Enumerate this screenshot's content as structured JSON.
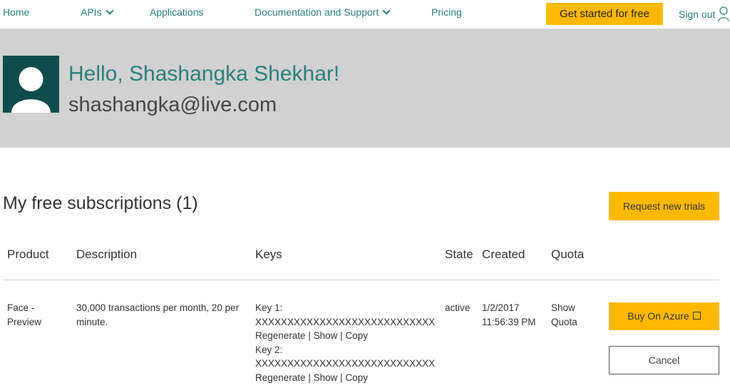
{
  "nav": {
    "home": "Home",
    "apis": "APIs",
    "applications": "Applications",
    "docs": "Documentation and Support",
    "pricing": "Pricing",
    "cta": "Get started for free",
    "signout": "Sign out"
  },
  "profile": {
    "greeting": "Hello, Shashangka Shekhar!",
    "email": "shashangka@live.com"
  },
  "subscriptions": {
    "title": "My free subscriptions (1)",
    "request_button": "Request new trials",
    "columns": [
      "Product",
      "Description",
      "Keys",
      "State",
      "Created",
      "Quota"
    ],
    "rows": [
      {
        "product": "Face - Preview",
        "description": "30,000 transactions per month, 20 per minute.",
        "key1_label": "Key 1:",
        "key1_value": "XXXXXXXXXXXXXXXXXXXXXXXXXXXX",
        "key2_label": "Key 2:",
        "key2_value": "XXXXXXXXXXXXXXXXXXXXXXXXXXXX",
        "regenerate": "Regenerate",
        "show": "Show",
        "copy": "Copy",
        "separator": "|",
        "state": "active",
        "created": "1/2/2017 11:56:39 PM",
        "quota": "Show Quota",
        "buy_button": "Buy On Azure",
        "cancel_button": "Cancel"
      }
    ]
  },
  "colors": {
    "accent": "#2a8078",
    "cta": "#ffb900",
    "banner": "#d2d2d2",
    "avatar_bg": "#0f4c4c"
  },
  "icons": [
    "chevron-down-icon",
    "person-icon",
    "avatar-icon",
    "external-link-icon"
  ]
}
